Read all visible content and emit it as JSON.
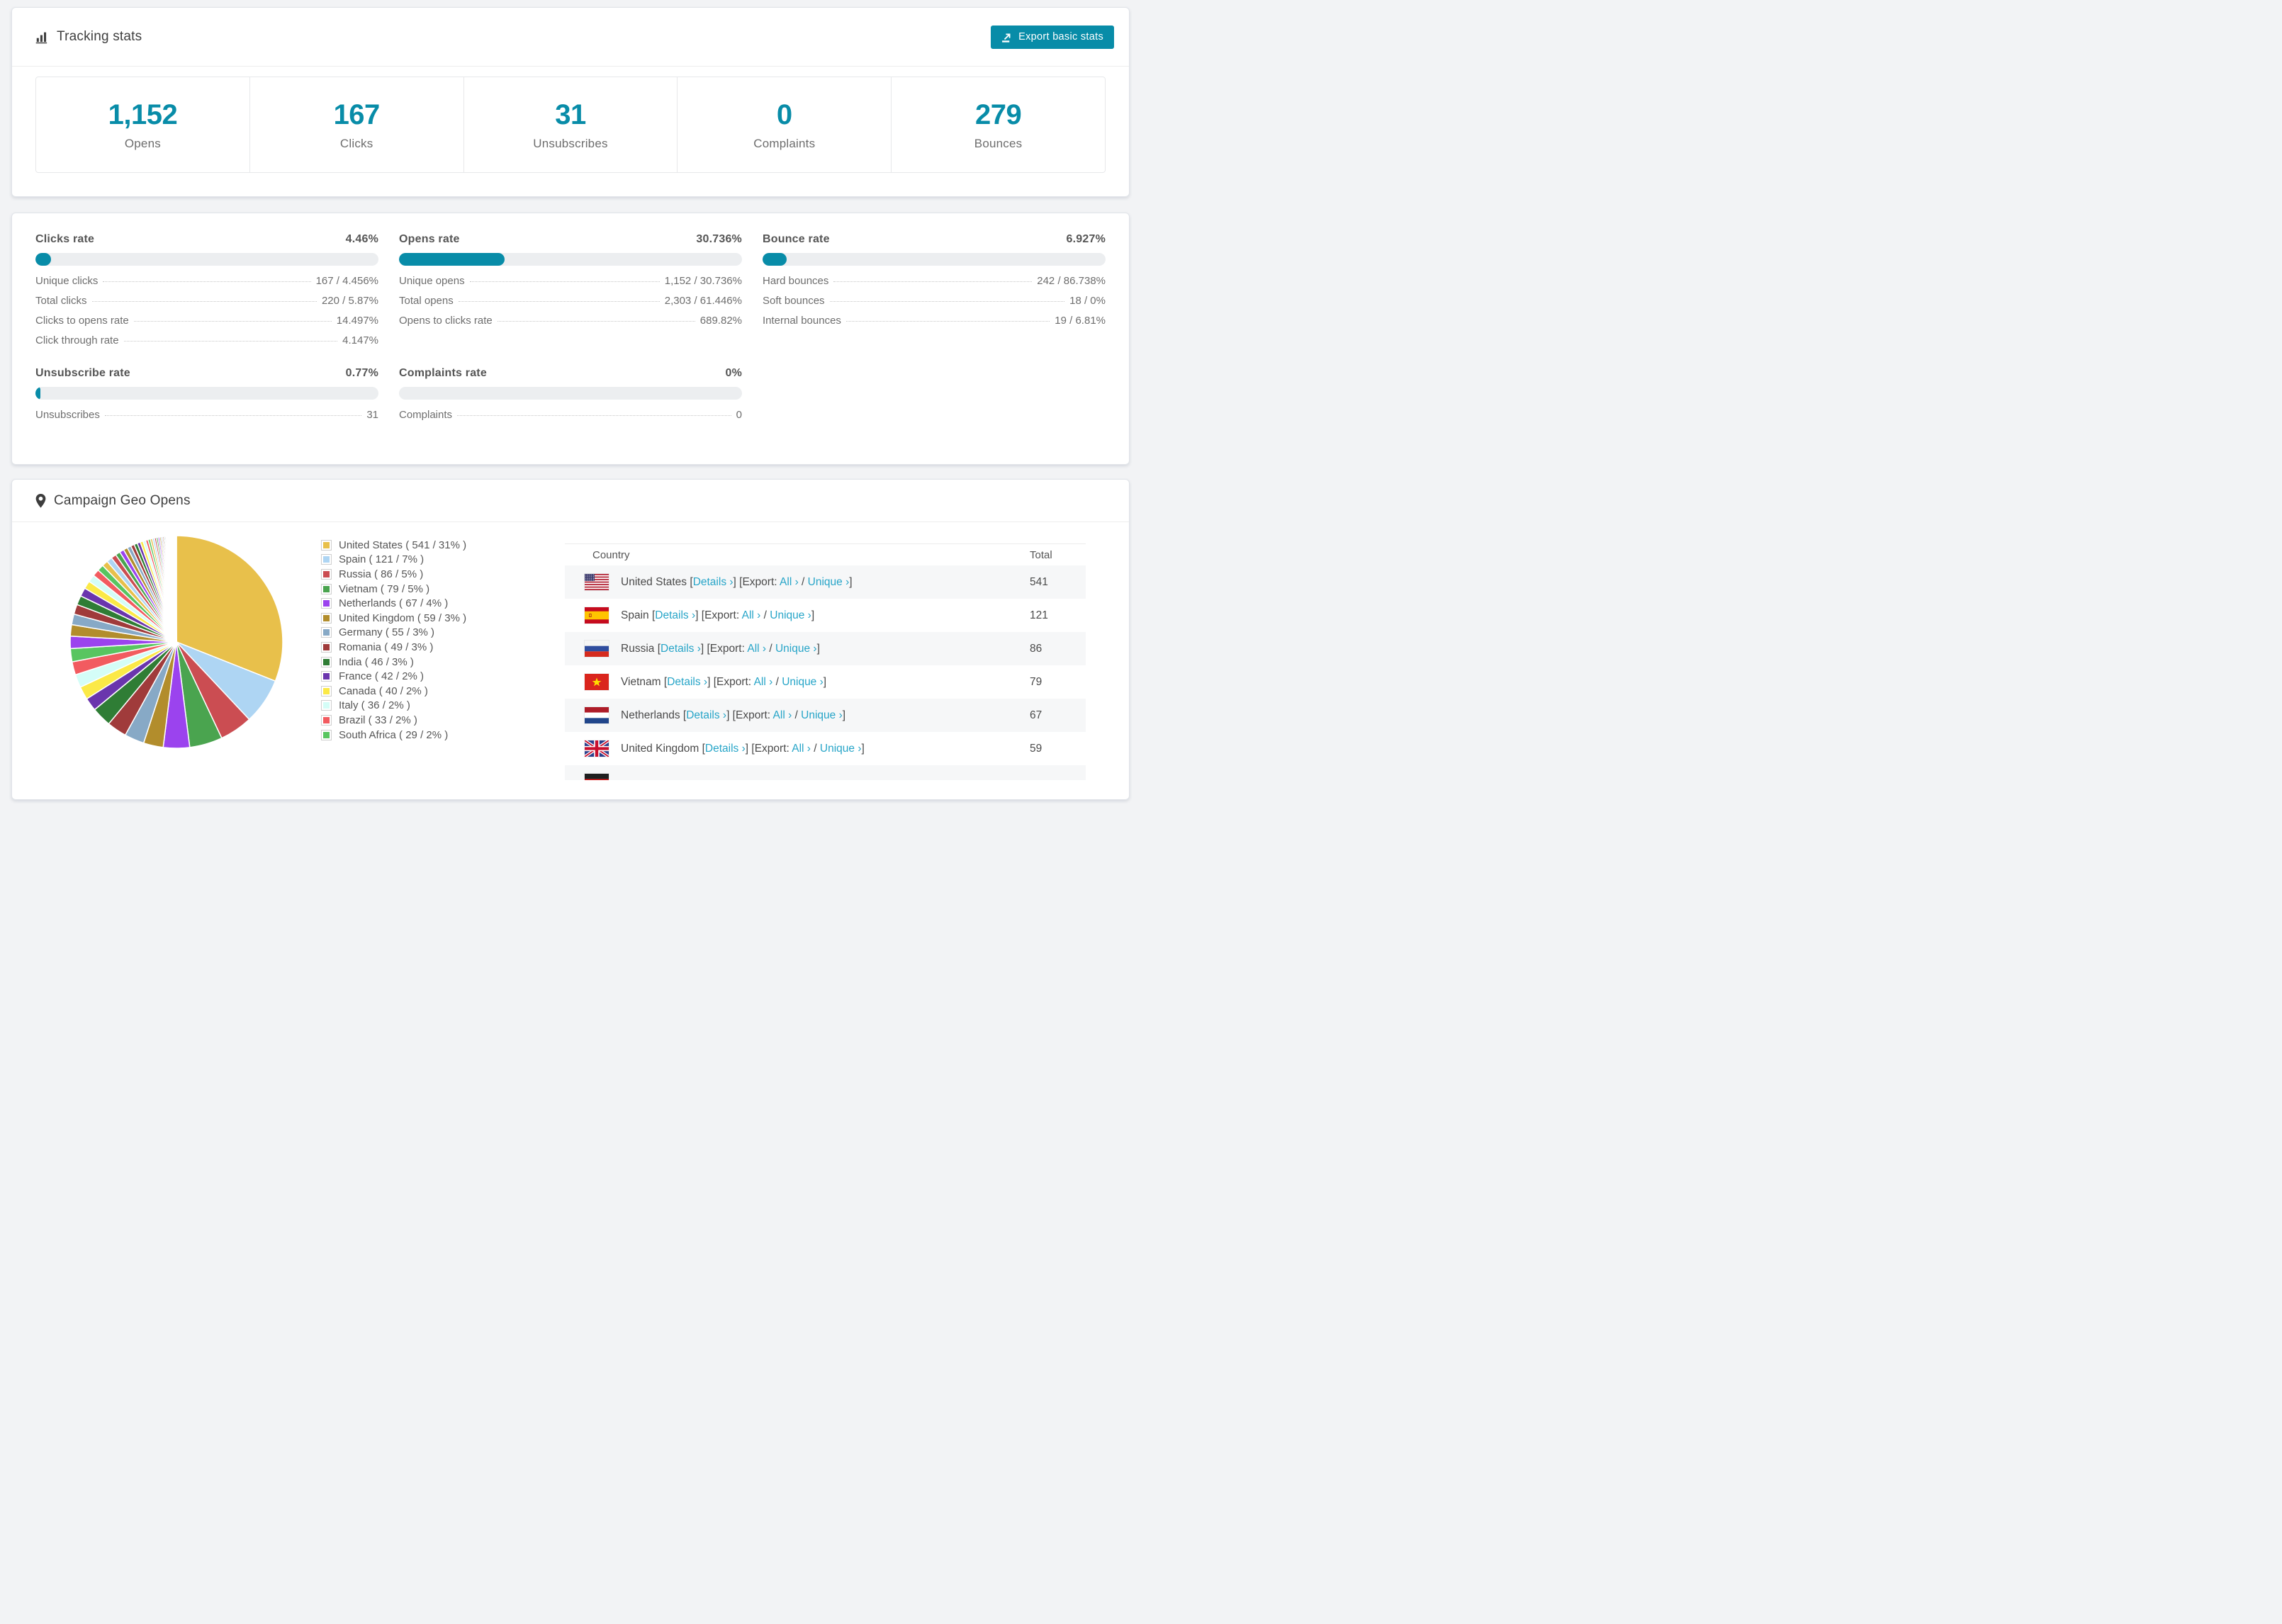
{
  "colors": {
    "accent_teal": "#088ca8",
    "link_teal": "#27a5c8",
    "bar_track": "#eceef0",
    "table_stripe": "#f6f7f8",
    "palette": [
      "#e8c04b",
      "#aed5f3",
      "#cb4d52",
      "#4aa44f",
      "#9b43ee",
      "#b28d2c",
      "#87a9c6",
      "#a03b3b",
      "#2f7d35",
      "#6a35ad",
      "#fbe947",
      "#d4fdf7",
      "#f25b60",
      "#58c560"
    ]
  },
  "tracking": {
    "title": "Tracking stats",
    "export_button": "Export basic stats",
    "stats": [
      {
        "value": "1,152",
        "label": "Opens"
      },
      {
        "value": "167",
        "label": "Clicks"
      },
      {
        "value": "31",
        "label": "Unsubscribes"
      },
      {
        "value": "0",
        "label": "Complaints"
      },
      {
        "value": "279",
        "label": "Bounces"
      }
    ]
  },
  "rates": {
    "sections": [
      {
        "title": "Clicks rate",
        "value": "4.46%",
        "percent": 4.46,
        "rows": [
          {
            "label": "Unique clicks",
            "value": "167 / 4.456%"
          },
          {
            "label": "Total clicks",
            "value": "220 / 5.87%"
          },
          {
            "label": "Clicks to opens rate",
            "value": "14.497%"
          },
          {
            "label": "Click through rate",
            "value": "4.147%"
          }
        ]
      },
      {
        "title": "Opens rate",
        "value": "30.736%",
        "percent": 30.736,
        "rows": [
          {
            "label": "Unique opens",
            "value": "1,152 / 30.736%"
          },
          {
            "label": "Total opens",
            "value": "2,303 / 61.446%"
          },
          {
            "label": "Opens to clicks rate",
            "value": "689.82%"
          }
        ]
      },
      {
        "title": "Bounce rate",
        "value": "6.927%",
        "percent": 6.927,
        "rows": [
          {
            "label": "Hard bounces",
            "value": "242 / 86.738%"
          },
          {
            "label": "Soft bounces",
            "value": "18 / 0%"
          },
          {
            "label": "Internal bounces",
            "value": "19 / 6.81%"
          }
        ]
      },
      {
        "title": "Unsubscribe rate",
        "value": "0.77%",
        "percent": 0.77,
        "rows": [
          {
            "label": "Unsubscribes",
            "value": "31"
          }
        ]
      },
      {
        "title": "Complaints rate",
        "value": "0%",
        "percent": 0,
        "rows": [
          {
            "label": "Complaints",
            "value": "0"
          }
        ]
      }
    ]
  },
  "geo": {
    "title": "Campaign Geo Opens",
    "table": {
      "headers": [
        "Country",
        "Total"
      ],
      "labels": {
        "details": "Details",
        "export": "Export:",
        "all": "All",
        "unique": "Unique",
        "chev": "›"
      },
      "rows": [
        {
          "country": "United States",
          "flag": "us",
          "total": "541",
          "partial": false
        },
        {
          "country": "Spain",
          "flag": "es",
          "total": "121",
          "partial": false
        },
        {
          "country": "Russia",
          "flag": "ru",
          "total": "86",
          "partial": false
        },
        {
          "country": "Vietnam",
          "flag": "vn",
          "total": "79",
          "partial": false
        },
        {
          "country": "Netherlands",
          "flag": "nl",
          "total": "67",
          "partial": false
        },
        {
          "country": "United Kingdom",
          "flag": "gb",
          "total": "59",
          "partial": false
        },
        {
          "country": "",
          "flag": "de",
          "total": "",
          "partial": true
        }
      ]
    }
  },
  "chart_data": {
    "type": "pie",
    "title": "Campaign Geo Opens",
    "categories": [
      "United States",
      "Spain",
      "Russia",
      "Vietnam",
      "Netherlands",
      "United Kingdom",
      "Germany",
      "Romania",
      "India",
      "France",
      "Canada",
      "Italy",
      "Brazil",
      "South Africa"
    ],
    "values": [
      541,
      121,
      86,
      79,
      67,
      59,
      55,
      49,
      46,
      42,
      40,
      36,
      33,
      29
    ],
    "percents": [
      31,
      7,
      5,
      5,
      4,
      3,
      3,
      3,
      3,
      2,
      2,
      2,
      2,
      2
    ],
    "colors": [
      "#e8c04b",
      "#aed5f3",
      "#cb4d52",
      "#4aa44f",
      "#9b43ee",
      "#b28d2c",
      "#87a9c6",
      "#a03b3b",
      "#2f7d35",
      "#6a35ad",
      "#fbe947",
      "#d4fdf7",
      "#f25b60",
      "#58c560"
    ],
    "others_percent_total": 26,
    "others_note": "remainder split across many small unlabeled slices, thinning toward 12 o'clock",
    "legend_position": "right",
    "start_angle": "12 o'clock, clockwise"
  }
}
